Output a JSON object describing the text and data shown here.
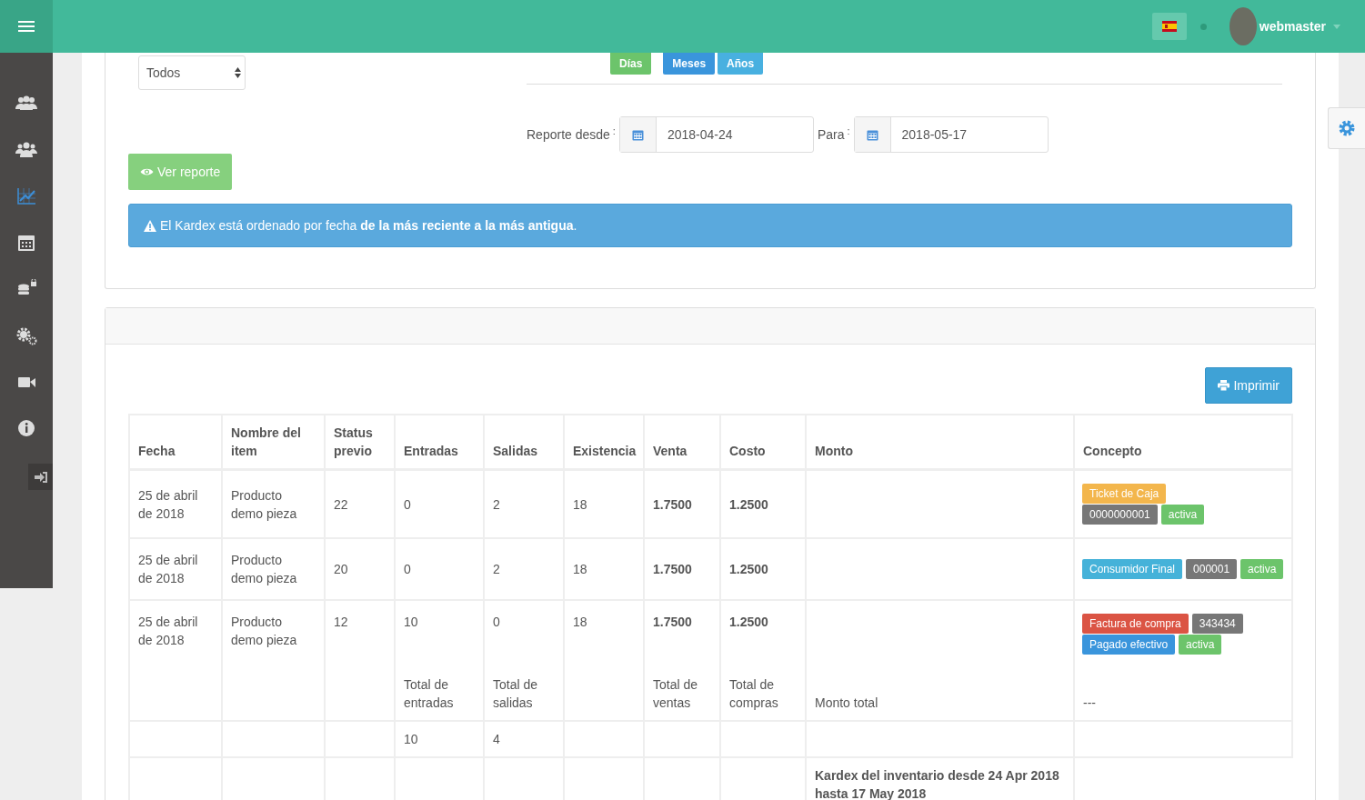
{
  "topbar": {
    "user": "webmaster"
  },
  "sidebar": {
    "items": [
      {
        "selected": false
      },
      {
        "selected": false
      },
      {
        "selected": true
      },
      {
        "selected": false
      },
      {
        "selected": false
      },
      {
        "selected": false
      },
      {
        "selected": false
      },
      {
        "selected": false
      }
    ]
  },
  "filters": {
    "select": {
      "value": "Todos"
    },
    "periods": [
      {
        "label": "Días",
        "color": "#6cc46b"
      },
      {
        "label": "Meses",
        "color": "#3a95dc"
      },
      {
        "label": "Años",
        "color": "#48b0e0"
      }
    ],
    "from_label": "Reporte desde",
    "from_sep": ":",
    "from_value": "2018-04-24",
    "to_label": "Para",
    "to_sep": ":",
    "to_value": "2018-05-17",
    "submit": "Ver reporte",
    "alert": "El Kardex está ordenado por fecha **de la más reciente a la más antigua**."
  },
  "report": {
    "print_button": "Imprimir",
    "columns": [
      "Fecha",
      "Nombre del item",
      "Status previo",
      "Entradas",
      "Salidas",
      "Existencia",
      "Venta",
      "Costo",
      "Monto",
      "Concepto"
    ],
    "rows": [
      {
        "kind": "item",
        "cells": [
          "25 de abril de 2018",
          "Producto demo pieza",
          "22",
          "0",
          "2",
          "18",
          "1.7500",
          "1.2500",
          null
        ],
        "concepto": [
          [
            {
              "text": "Ticket de Caja",
              "color": "#f3b64c"
            }
          ],
          [
            {
              "text": "0000000001",
              "color": "#777777"
            },
            {
              "text": "activa",
              "color": "#6cc46b"
            }
          ]
        ]
      },
      {
        "kind": "item",
        "cells": [
          "25 de abril de 2018",
          "Producto demo pieza",
          "20",
          "0",
          "2",
          "18",
          "1.7500",
          "1.2500",
          null
        ],
        "concepto": [
          [
            {
              "text": "Consumidor Final",
              "color": "#45b2d9"
            },
            {
              "text": "000001",
              "color": "#777777"
            },
            {
              "text": "activa",
              "color": "#6cc46b"
            }
          ]
        ]
      },
      {
        "kind": "item",
        "cells": [
          "25 de abril de 2018",
          "Producto demo pieza",
          "12",
          "10",
          "0",
          "18",
          "1.7500",
          "1.2500",
          null
        ],
        "concepto": [
          [
            {
              "text": "Factura de compra",
              "color": "#db5444"
            },
            {
              "text": "343434",
              "color": "#777777"
            }
          ],
          [
            {
              "text": "Pagado efectivo",
              "color": "#3a95dc"
            },
            {
              "text": "activa",
              "color": "#6cc46b"
            }
          ]
        ]
      },
      {
        "kind": "labels",
        "cells": [
          null,
          null,
          null,
          "Total de entradas",
          "Total de salidas",
          null,
          "Total de ventas",
          "Total de compras",
          "Monto total",
          "---"
        ]
      },
      {
        "kind": "totals",
        "cells": [
          null,
          null,
          null,
          "10",
          "4",
          null,
          null,
          null,
          null,
          null
        ]
      },
      {
        "kind": "caption",
        "cells": [
          null,
          null,
          null,
          null,
          null,
          null,
          null,
          null,
          "Kardex del inventario desde 24 Apr 2018 hasta 17 May 2018"
        ]
      }
    ]
  }
}
